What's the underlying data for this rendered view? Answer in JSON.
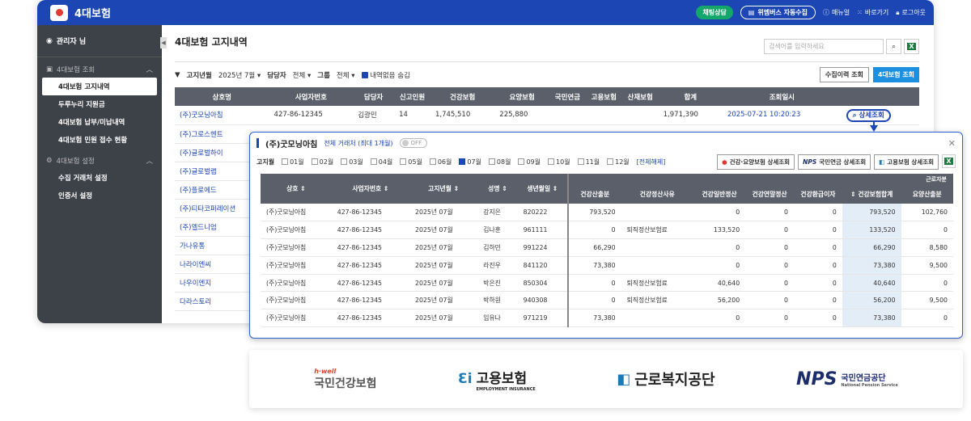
{
  "app": {
    "title": "4대보험",
    "counsel": "채팅상담",
    "auto_collect": "위멤버스 자동수집",
    "manual": "매뉴얼",
    "shortcut": "바로가기",
    "logout": "로그아웃"
  },
  "sidebar": {
    "user": "관리자 님",
    "sections": [
      {
        "label": "4대보험 조회",
        "items": [
          "4대보험 고지내역",
          "두루누리 지원금",
          "4대보험 납부/미납내역",
          "4대보험 민원 접수 현황"
        ]
      },
      {
        "label": "4대보험 설정",
        "items": [
          "수집 거래처 설정",
          "인증서 설정"
        ]
      }
    ]
  },
  "main": {
    "title": "4대보험 고지내역",
    "search_placeholder": "검색어를 입력하세요",
    "filters": {
      "period_label": "고지년월",
      "period_value": "2025년 7월",
      "manager_label": "담당자",
      "manager_value": "전체",
      "group_label": "그룹",
      "group_value": "전체",
      "hide_empty": "내역없음 숨김"
    },
    "btn_history": "수집이력 조회",
    "btn_query": "4대보험 조회",
    "columns": [
      "상호명",
      "사업자번호",
      "담당자",
      "신고인원",
      "건강보험",
      "요양보험",
      "국민연금",
      "고용보험",
      "산재보험",
      "합계",
      "조회일시",
      ""
    ],
    "row": {
      "name": "(주)굿모닝아침",
      "bizno": "427-86-12345",
      "manager": "김광민",
      "count": "14",
      "health": "1,745,510",
      "care": "225,880",
      "total": "1,971,390",
      "date": "2025-07-21 10:20:23",
      "detail": "상세조회"
    },
    "names": [
      "(주)그로스헨트",
      "(주)글로벌하이",
      "(주)글로벌랩",
      "(주)플로에드",
      "(주)티타코퍼레이션",
      "(주)엘드니엄",
      "가나유통",
      "나라이엔씨",
      "나우이엔지",
      "다라스토리"
    ]
  },
  "popup": {
    "company": "(주)굿모닝아침",
    "sub": "전체 거래처 (최대 1개월)",
    "toggle": "OFF",
    "month_label": "고지월",
    "months": [
      "01월",
      "02월",
      "03월",
      "04월",
      "05월",
      "06월",
      "07월",
      "08월",
      "09월",
      "10월",
      "11월",
      "12월"
    ],
    "clear": "[전체해제]",
    "btn_health": "건강·요양보험 상세조회",
    "btn_nps": "국민연금 상세조회",
    "btn_emp": "고용보험 상세조회",
    "nps_tag": "NPS",
    "group_header": "근로자분",
    "columns": [
      "상호",
      "사업자번호",
      "고지년월",
      "성명",
      "생년월일",
      "건강산출분",
      "건강정산사유",
      "건강일반정산",
      "건강연말정산",
      "건강환급이자",
      "건강보험합계",
      "요양산출분"
    ],
    "rows": [
      [
        "(주)굿모닝아침",
        "427-86-12345",
        "2025년 07월",
        "강지은",
        "820222",
        "793,520",
        "",
        "0",
        "0",
        "0",
        "793,520",
        "102,760"
      ],
      [
        "(주)굿모닝아침",
        "427-86-12345",
        "2025년 07월",
        "김나훈",
        "961111",
        "0",
        "퇴직정산보험료",
        "133,520",
        "0",
        "0",
        "133,520",
        "0"
      ],
      [
        "(주)굿모닝아침",
        "427-86-12345",
        "2025년 07월",
        "김하민",
        "991224",
        "66,290",
        "",
        "0",
        "0",
        "0",
        "66,290",
        "8,580"
      ],
      [
        "(주)굿모닝아침",
        "427-86-12345",
        "2025년 07월",
        "라진우",
        "841120",
        "73,380",
        "",
        "0",
        "0",
        "0",
        "73,380",
        "9,500"
      ],
      [
        "(주)굿모닝아침",
        "427-86-12345",
        "2025년 07월",
        "박은진",
        "850304",
        "0",
        "퇴직정산보험료",
        "40,640",
        "0",
        "0",
        "40,640",
        "0"
      ],
      [
        "(주)굿모닝아침",
        "427-86-12345",
        "2025년 07월",
        "박하원",
        "940308",
        "0",
        "퇴직정산보험료",
        "56,200",
        "0",
        "0",
        "56,200",
        "9,500"
      ],
      [
        "(주)굿모닝아침",
        "427-86-12345",
        "2025년 07월",
        "임유나",
        "971219",
        "73,380",
        "",
        "0",
        "0",
        "0",
        "73,380",
        "0"
      ]
    ]
  },
  "logos": {
    "nhis_tag": "h·well",
    "nhis": "국민건강보험",
    "emp": "고용보험",
    "emp_sub": "EMPLOYMENT INSURANCE",
    "comwel": "근로복지공단",
    "nps": "NPS",
    "nps_name": "국민연금공단",
    "nps_sub": "National Pension Service"
  }
}
